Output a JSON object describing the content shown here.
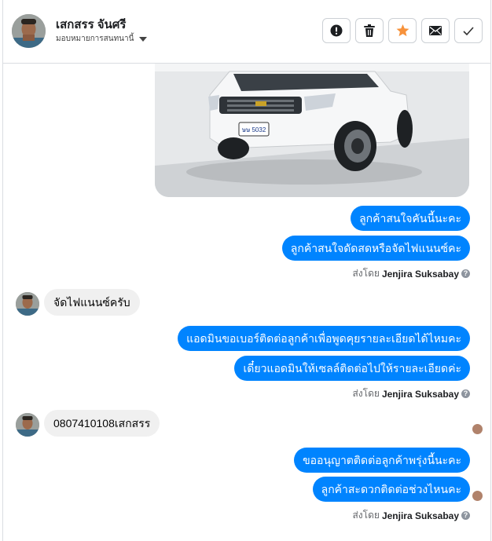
{
  "header": {
    "contact_name": "เสกสรร จันศรี",
    "assign_label": "มอบหมายการสนทนานี้",
    "actions": [
      "mark-spam",
      "delete",
      "star",
      "mark-unread",
      "done"
    ]
  },
  "messages": {
    "out1": "ลูกค้าสนใจคันนี้นะคะ",
    "out2": "ลูกค้าสนใจดัดสดหรือจัดไฟแนนซ์คะ",
    "sent_by_prefix": "ส่งโดย",
    "sent_by_name": "Jenjira Suksabay",
    "in1": "จัดไฟแนนซ์ครับ",
    "out3": "แอดมินขอเบอร์ติดต่อลูกค้าเพื่อพูดคุยรายละเอียดได้ไหมคะ",
    "out4": "เดี๋ยวแอดมินให้เซลล์ติดต่อไปให้รายละเอียดค่ะ",
    "in2": "0807410108เสกสรร",
    "out5": "ขออนุญาตติดต่อลูกค้าพรุ่งนี้นะคะ",
    "out6": "ลูกค้าสะดวกติดต่อช่วงไหนคะ",
    "car_plate": "ษษ 5032"
  },
  "colors": {
    "accent": "#0084ff",
    "incoming": "#f0f0f0",
    "star": "#f7923b"
  }
}
